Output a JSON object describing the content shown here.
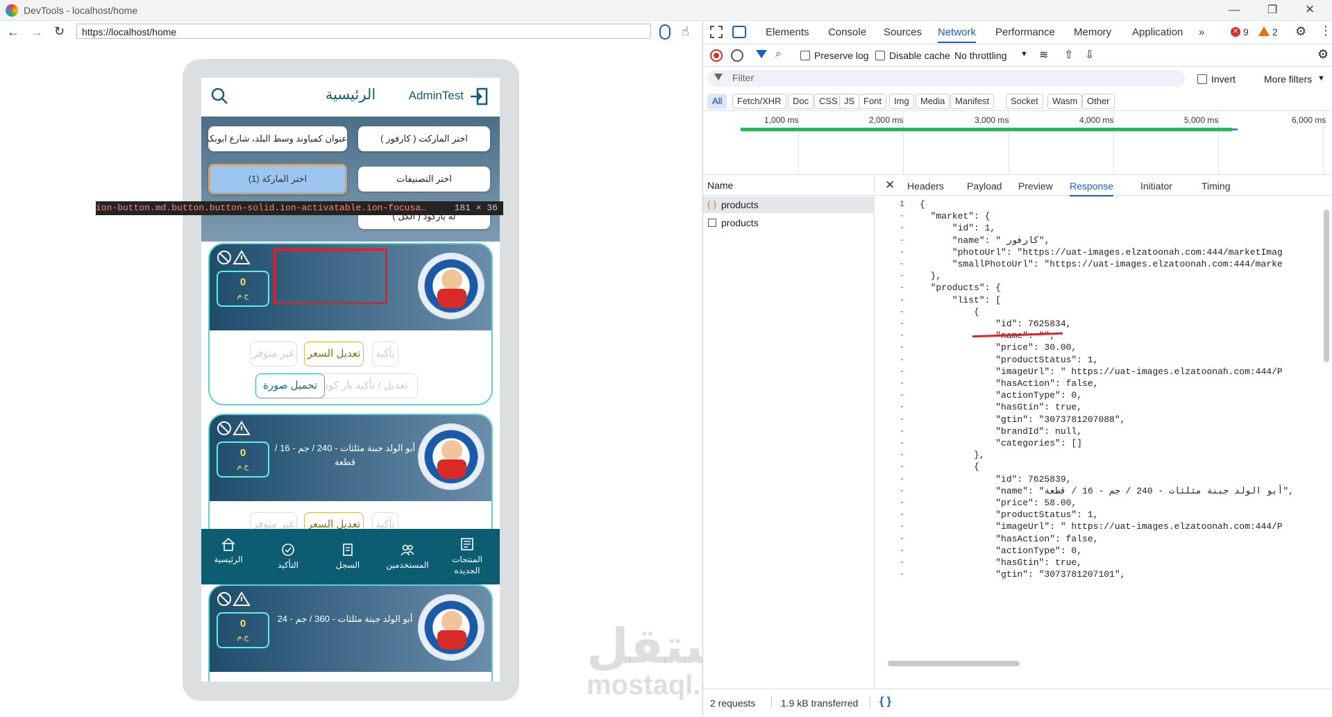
{
  "window": {
    "title": "DevTools - localhost/home"
  },
  "browser": {
    "url": "https://localhost/home"
  },
  "app": {
    "header_title": "الرئيسية",
    "user": "AdminTest",
    "filters": {
      "market": "اختر الماركت ( كارفور )",
      "address": "عنوان كمباوند وسط البلد، شارع ابوبكر",
      "categories": "اختر التصنيفات",
      "brand": "اختر الماركة (1)",
      "barcode": "له باركود ( الكل )"
    },
    "products": [
      {
        "name": "",
        "qty": "0",
        "currency": "ج.م"
      },
      {
        "name": "أبو الولد جبنة مثلثات - 240 / جم - 16 / قطعة",
        "qty": "0",
        "currency": "ج.م"
      },
      {
        "name": "أبو الولد جبنة مثلثات - 360 / جم - 24",
        "qty": "0",
        "currency": "ج.م"
      }
    ],
    "actions": {
      "confirm": "تأكيد",
      "edit_price": "تعديل السعر",
      "not_available": "غير متوفر",
      "edit_barcode": "تعديل / تأكيد بار كود",
      "upload_image": "تحميل صورة"
    },
    "tabs": [
      "الرئيسية",
      "التأكيد",
      "السجل",
      "المستخدمين",
      "المنتجات الجديده"
    ]
  },
  "inspector_tooltip": {
    "selector": "ion-button.md.button.button-solid.ion-activatable.ion-focusa…",
    "size": "181 × 36"
  },
  "watermark": {
    "arabic": "مستقل",
    "latin": "mostaql.com"
  },
  "devtools": {
    "tabs": [
      "Elements",
      "Console",
      "Sources",
      "Network",
      "Performance",
      "Memory",
      "Application"
    ],
    "active_tab": "Network",
    "errors": "9",
    "warnings": "2",
    "toolbar": {
      "preserve_log": "Preserve log",
      "disable_cache": "Disable cache",
      "throttling": "No throttling"
    },
    "filter_placeholder": "Filter",
    "invert": "Invert",
    "more_filters": "More filters",
    "type_filters": [
      "All",
      "Fetch/XHR",
      "Doc",
      "CSS",
      "JS",
      "Font",
      "Img",
      "Media",
      "Manifest",
      "Socket",
      "Wasm",
      "Other"
    ],
    "timeline_ticks": [
      "1,000 ms",
      "2,000 ms",
      "3,000 ms",
      "4,000 ms",
      "5,000 ms",
      "6,000 ms"
    ],
    "name_header": "Name",
    "requests": [
      "products",
      "products"
    ],
    "panel_tabs": [
      "Headers",
      "Payload",
      "Preview",
      "Response",
      "Initiator",
      "Timing"
    ],
    "active_panel_tab": "Response",
    "status": {
      "requests": "2 requests",
      "transferred": "1.9 kB transferred"
    },
    "response_lines": [
      {
        "n": "1",
        "t": "{"
      },
      {
        "n": "-",
        "t": "  \"market\": {"
      },
      {
        "n": "-",
        "t": "      \"id\": 1,"
      },
      {
        "n": "-",
        "t": "      \"name\": \" كارفور\","
      },
      {
        "n": "-",
        "t": "      \"photoUrl\": \"https://uat-images.elzatoonah.com:444/marketImag"
      },
      {
        "n": "-",
        "t": "      \"smallPhotoUrl\": \"https://uat-images.elzatoonah.com:444/marke"
      },
      {
        "n": "-",
        "t": "  },"
      },
      {
        "n": "-",
        "t": "  \"products\": {"
      },
      {
        "n": "-",
        "t": "      \"list\": ["
      },
      {
        "n": "-",
        "t": "          {"
      },
      {
        "n": "-",
        "t": "              \"id\": 7625834,"
      },
      {
        "n": "-",
        "t": "              \"name\": \"\","
      },
      {
        "n": "-",
        "t": "              \"price\": 30.00,"
      },
      {
        "n": "-",
        "t": "              \"productStatus\": 1,"
      },
      {
        "n": "-",
        "t": "              \"imageUrl\": \" https://uat-images.elzatoonah.com:444/P"
      },
      {
        "n": "-",
        "t": "              \"hasAction\": false,"
      },
      {
        "n": "-",
        "t": "              \"actionType\": 0,"
      },
      {
        "n": "-",
        "t": "              \"hasGtin\": true,"
      },
      {
        "n": "-",
        "t": "              \"gtin\": \"3073781207088\","
      },
      {
        "n": "-",
        "t": "              \"brandId\": null,"
      },
      {
        "n": "-",
        "t": "              \"categories\": []"
      },
      {
        "n": "-",
        "t": "          },"
      },
      {
        "n": "-",
        "t": "          {"
      },
      {
        "n": "-",
        "t": "              \"id\": 7625839,"
      },
      {
        "n": "-",
        "t": "              \"name\": \"أبو الولد جبنة مثلثات - 240 / جم - 16 / قطعة\","
      },
      {
        "n": "-",
        "t": "              \"price\": 58.00,"
      },
      {
        "n": "-",
        "t": "              \"productStatus\": 1,"
      },
      {
        "n": "-",
        "t": "              \"imageUrl\": \" https://uat-images.elzatoonah.com:444/P"
      },
      {
        "n": "-",
        "t": "              \"hasAction\": false,"
      },
      {
        "n": "-",
        "t": "              \"actionType\": 0,"
      },
      {
        "n": "-",
        "t": "              \"hasGtin\": true,"
      },
      {
        "n": "-",
        "t": "              \"gtin\": \"3073781207101\","
      }
    ]
  },
  "colors": {
    "accent": "#1a5fc9",
    "app_primary": "#0c5d72",
    "highlight_box": "#e0202a",
    "timeline_bar": "#2fb25a"
  }
}
